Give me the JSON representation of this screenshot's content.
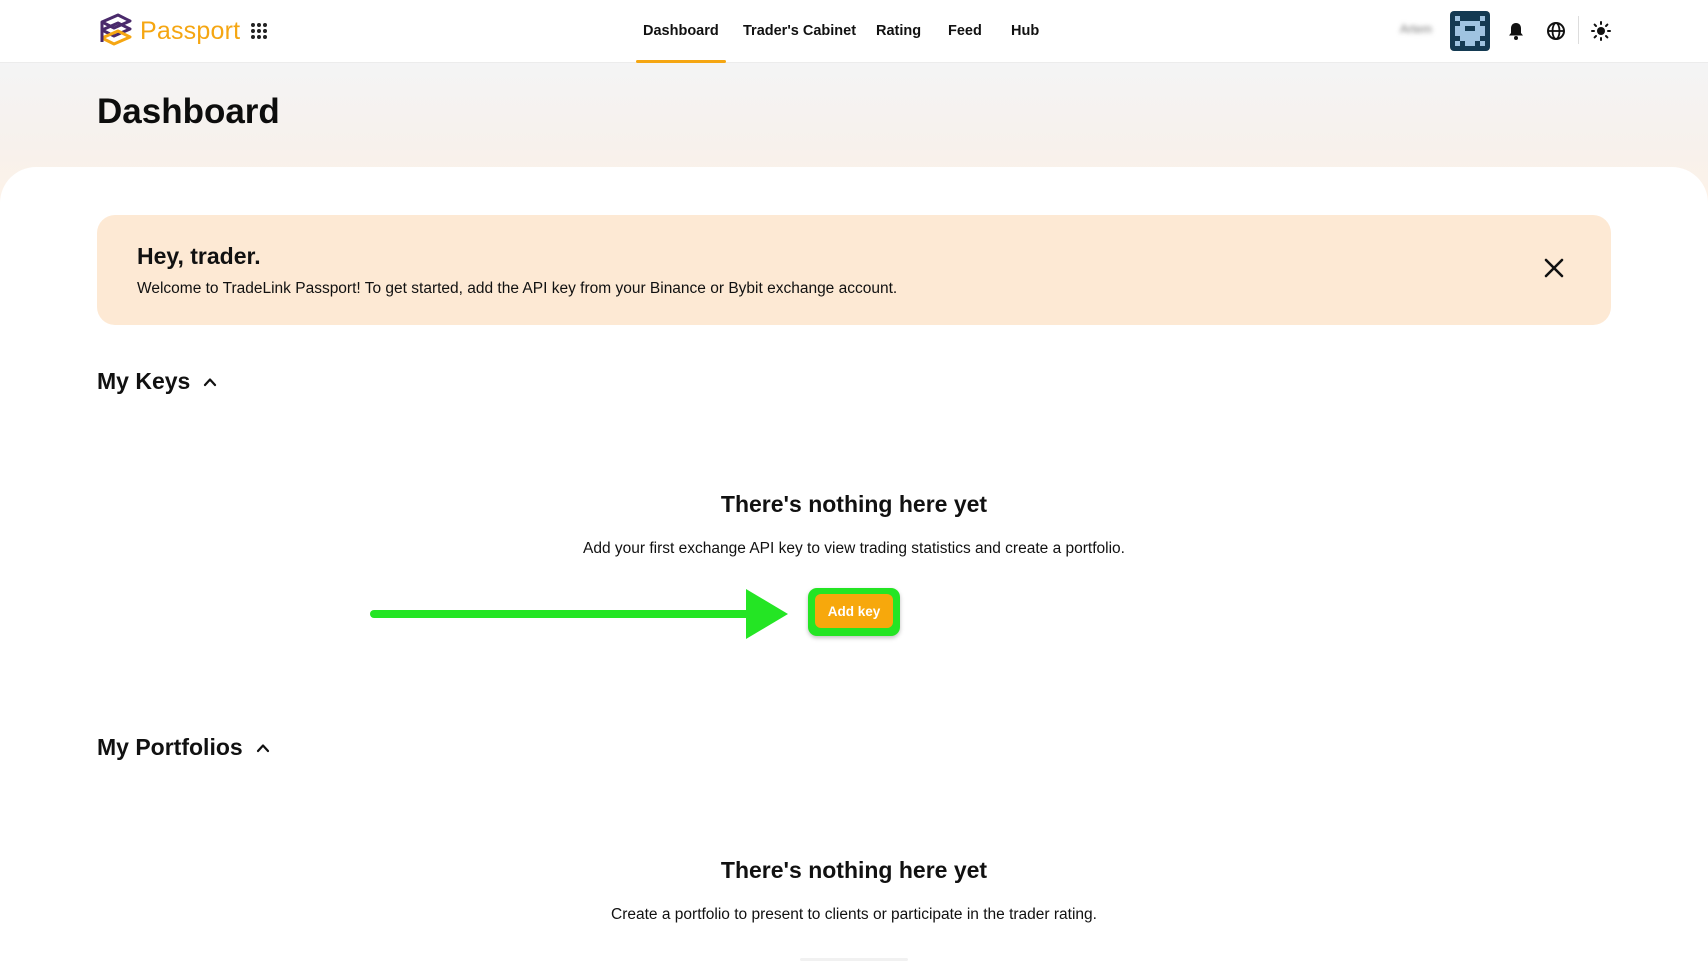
{
  "app": {
    "logo_text": "Passport",
    "brand_color": "#f5a612",
    "logo_icon": "passport-logo-icon",
    "apps_icon": "grid-apps-icon"
  },
  "nav": {
    "items": [
      {
        "label": "Dashboard",
        "active": true
      },
      {
        "label": "Trader's Cabinet",
        "active": false
      },
      {
        "label": "Rating",
        "active": false
      },
      {
        "label": "Feed",
        "active": false
      },
      {
        "label": "Hub",
        "active": false
      }
    ]
  },
  "header": {
    "user_name": "Artem",
    "icons": [
      "bell-icon",
      "globe-icon",
      "sun-icon"
    ]
  },
  "page": {
    "title": "Dashboard"
  },
  "banner": {
    "title": "Hey, trader.",
    "text": "Welcome to TradeLink Passport! To get started, add the API key from your Binance or Bybit exchange account.",
    "background": "#fde9d4"
  },
  "keys_section": {
    "title": "My Keys",
    "empty_title": "There's nothing here yet",
    "empty_text": "Add your first exchange API key to view trading statistics and create a portfolio.",
    "button_label": "Add key",
    "button_color": "#f7a80c",
    "highlight_color": "#24e524"
  },
  "portfolios_section": {
    "title": "My Portfolios",
    "empty_title": "There's nothing here yet",
    "empty_text": "Create a portfolio to present to clients or participate in the trader rating."
  }
}
